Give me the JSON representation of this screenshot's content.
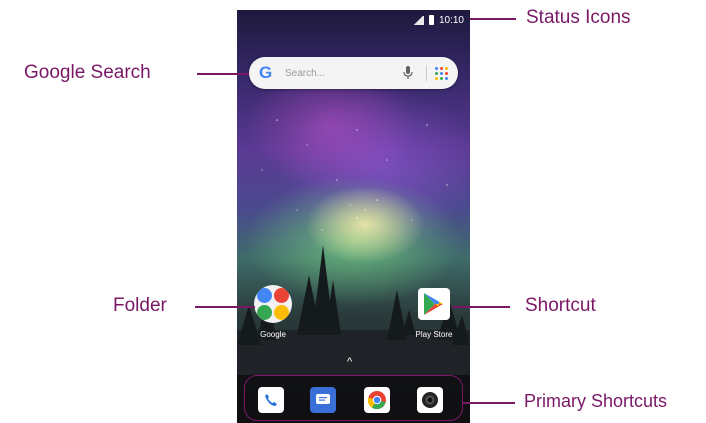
{
  "phone": {
    "status_bar": {
      "time": "10:10"
    },
    "search_bar": {
      "placeholder": "Search..."
    },
    "home_apps": [
      {
        "label": "Google"
      },
      {
        "label": "Play Store"
      }
    ],
    "dock": [
      "phone-icon",
      "messages-icon",
      "chrome-icon",
      "camera-icon"
    ]
  },
  "callouts": {
    "status_icons": "Status Icons",
    "google_search": "Google Search",
    "folder": "Folder",
    "shortcut": "Shortcut",
    "primary_shortcuts": "Primary Shortcuts"
  },
  "colors": {
    "callout": "#7a1866",
    "dock_bg": "#0f0f12",
    "google_blue": "#4285f4",
    "google_red": "#ea4335",
    "google_yellow": "#fbbc05",
    "google_green": "#34a853"
  }
}
